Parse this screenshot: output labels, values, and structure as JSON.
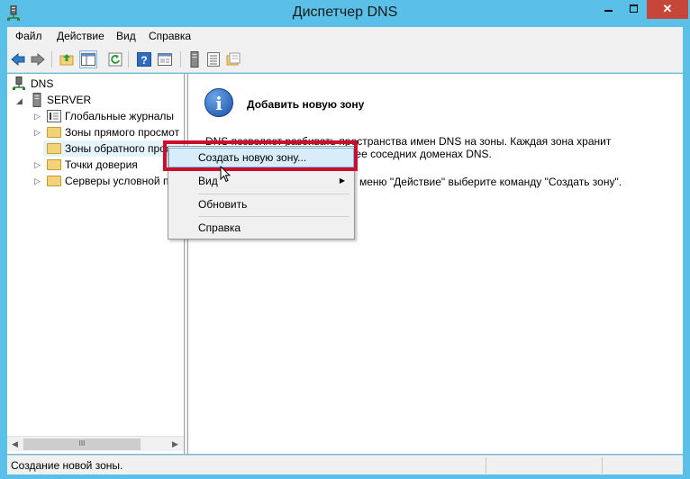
{
  "window": {
    "title": "Диспетчер DNS",
    "minimize_glyph": "—",
    "close_glyph": "✕"
  },
  "menubar": {
    "items": [
      "Файл",
      "Действие",
      "Вид",
      "Справка"
    ]
  },
  "toolbar": {
    "buttons": [
      "back-icon",
      "forward-icon",
      "up-folder-icon",
      "show-hide-tree-icon",
      "refresh-icon",
      "help-icon",
      "properties-icon",
      "server-icon",
      "list-icon",
      "folder-view-icon"
    ]
  },
  "tree": {
    "root": "DNS",
    "server": "SERVER",
    "items": [
      {
        "label": "Глобальные журналы",
        "icon": "log-icon"
      },
      {
        "label": "Зоны прямого просмот",
        "icon": "folder-icon"
      },
      {
        "label": "Зоны обратного прос",
        "icon": "folder-icon"
      },
      {
        "label": "Точки доверия",
        "icon": "folder-icon"
      },
      {
        "label": "Серверы условной п",
        "icon": "folder-icon"
      }
    ]
  },
  "scrollbar": {
    "left_arrow": "◀",
    "right_arrow": "▶",
    "grip": "III"
  },
  "panel": {
    "heading": "Добавить новую зону",
    "icon": "info-icon",
    "line1": "DNS позволяет разбивать пространства имен DNS на зоны. Каждая зона хранит",
    "line2": "олее соседних доменах DNS.",
    "line3": "меню \"Действие\" выберите команду \"Создать зону\"."
  },
  "context_menu": {
    "items": [
      "Создать новую зону...",
      "Вид",
      "Обновить",
      "Справка"
    ],
    "submenu_arrow": "▶",
    "highlighted_index": 0,
    "highlight_color": "#c8102e"
  },
  "statusbar": {
    "text": "Создание новой зоны."
  },
  "colors": {
    "window_frame": "#5bc0e8",
    "close_button": "#c7463a"
  }
}
